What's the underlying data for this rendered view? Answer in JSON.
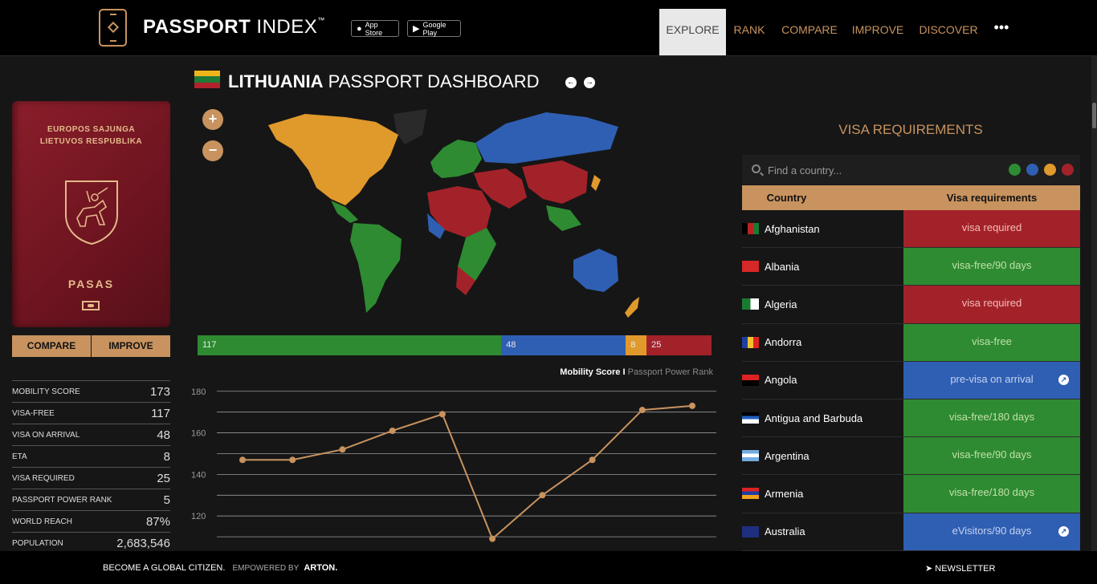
{
  "header": {
    "brand_bold": "PASSPORT",
    "brand_light": "INDEX",
    "trademark": "™",
    "app_store": "App Store",
    "google_play": "Google Play",
    "nav": [
      "EXPLORE",
      "RANK",
      "COMPARE",
      "IMPROVE",
      "DISCOVER"
    ],
    "more": "•••"
  },
  "passport": {
    "line1": "EUROPOS SAJUNGA",
    "line2": "LIETUVOS RESPUBLIKA",
    "title": "PASAS",
    "compare_button": "COMPARE",
    "improve_button": "IMPROVE"
  },
  "stats": [
    {
      "label": "MOBILITY SCORE",
      "value": "173"
    },
    {
      "label": "VISA-FREE",
      "value": "117"
    },
    {
      "label": "VISA ON ARRIVAL",
      "value": "48"
    },
    {
      "label": "ETA",
      "value": "8"
    },
    {
      "label": "VISA REQUIRED",
      "value": "25"
    },
    {
      "label": "PASSPORT POWER RANK",
      "value": "5"
    },
    {
      "label": "WORLD REACH",
      "value": "87%"
    },
    {
      "label": "POPULATION",
      "value": "2,683,546"
    }
  ],
  "dashboard": {
    "country": "LITHUANIA",
    "title_rest": "PASSPORT DASHBOARD",
    "zoom_in": "+",
    "zoom_out": "−",
    "prev": "←",
    "next": "→"
  },
  "distribution": [
    {
      "value": 117,
      "color": "#2e8b32"
    },
    {
      "value": 48,
      "color": "#2f5fb3"
    },
    {
      "value": 8,
      "color": "#e0992b"
    },
    {
      "value": 25,
      "color": "#a3222a"
    }
  ],
  "chart_legend": {
    "active": "Mobility Score",
    "separator": "I",
    "inactive": "Passport Power Rank"
  },
  "chart_data": {
    "type": "line",
    "series": [
      {
        "values": [
          147,
          147,
          152,
          161,
          169,
          109,
          130,
          147,
          171,
          173
        ]
      }
    ],
    "ylim": [
      100,
      183
    ],
    "yticks": [
      180,
      160,
      140,
      120
    ],
    "grid": true,
    "color": "#c8935f"
  },
  "visa_panel": {
    "title": "VISA REQUIREMENTS",
    "search_placeholder": "Find a country...",
    "filters": [
      "#2e8b32",
      "#2f5fb3",
      "#e0992b",
      "#a3222a"
    ],
    "col_country": "Country",
    "col_requirements": "Visa requirements",
    "rows": [
      {
        "country": "Afghanistan",
        "requirement": "visa required",
        "status": "red"
      },
      {
        "country": "Albania",
        "requirement": "visa-free/90 days",
        "status": "green"
      },
      {
        "country": "Algeria",
        "requirement": "visa required",
        "status": "red"
      },
      {
        "country": "Andorra",
        "requirement": "visa-free",
        "status": "green"
      },
      {
        "country": "Angola",
        "requirement": "pre-visa on arrival",
        "status": "blue",
        "link": true
      },
      {
        "country": "Antigua and Barbuda",
        "requirement": "visa-free/180 days",
        "status": "green"
      },
      {
        "country": "Argentina",
        "requirement": "visa-free/90 days",
        "status": "green"
      },
      {
        "country": "Armenia",
        "requirement": "visa-free/180 days",
        "status": "green"
      },
      {
        "country": "Australia",
        "requirement": "eVisitors/90 days",
        "status": "blue",
        "link": true
      }
    ]
  },
  "footer": {
    "slogan": "BECOME A GLOBAL CITIZEN.",
    "empowered": "EMPOWERED BY",
    "arton": "ARTON.",
    "newsletter": "NEWSLETTER"
  }
}
